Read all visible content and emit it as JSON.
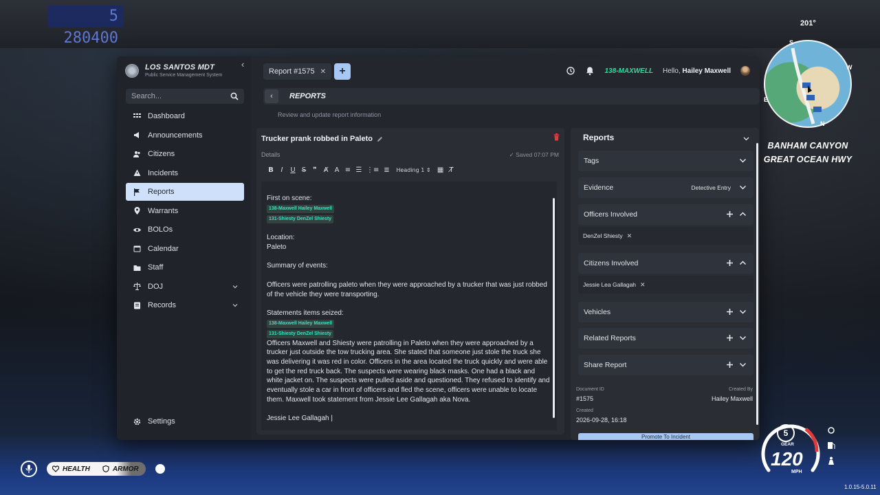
{
  "background": {
    "radio_display": "5 280400"
  },
  "brand": {
    "title": "LOS SANTOS MDT",
    "subtitle": "Public Service Management System"
  },
  "search": {
    "placeholder": "Search..."
  },
  "sidebar": {
    "items": [
      {
        "label": "Dashboard",
        "icon": "grid-icon"
      },
      {
        "label": "Announcements",
        "icon": "megaphone-icon"
      },
      {
        "label": "Citizens",
        "icon": "users-icon"
      },
      {
        "label": "Incidents",
        "icon": "warning-icon"
      },
      {
        "label": "Reports",
        "icon": "flag-icon",
        "active": true
      },
      {
        "label": "Warrants",
        "icon": "pin-icon"
      },
      {
        "label": "BOLOs",
        "icon": "eye-icon"
      },
      {
        "label": "Calendar",
        "icon": "calendar-icon"
      },
      {
        "label": "Staff",
        "icon": "folder-icon"
      },
      {
        "label": "DOJ",
        "icon": "scale-icon",
        "dropdown": true
      },
      {
        "label": "Records",
        "icon": "records-icon",
        "dropdown": true
      }
    ],
    "settings_label": "Settings"
  },
  "tabs": [
    {
      "label": "Report #1575"
    }
  ],
  "topbar": {
    "callsign": "138-MAXWELL",
    "hello_prefix": "Hello,",
    "user_name": "Hailey Maxwell"
  },
  "header": {
    "title": "REPORTS",
    "subtitle": "Review and update report information"
  },
  "editor": {
    "report_title": "Trucker prank robbed in Paleto",
    "details_label": "Details",
    "saved_text": "✓ Saved 07:07 PM",
    "heading_select": "Heading 1 ⇕",
    "content": {
      "first_on_scene_label": "First on scene:",
      "officer_tag_1": "138-Maxwell Hailey Maxwell",
      "officer_tag_2": "131-Shiesty DenZel Shiesty",
      "location_label": "Location:",
      "location_value": "Paleto",
      "summary_label": "Summary of events:",
      "summary_text": "Officers were patrolling paleto when they were approached by a trucker that was just robbed of the vehicle they were transporting.",
      "statements_label": "Statements items seized:",
      "statement_text": "Officers Maxwell and Shiesty were patrolling in Paleto when they were approached by a trucker just outside the tow trucking area. She stated that someone just stole the truck she was delivering it was red in color. Officers in the area located the truck quickly and were able to get the red truck back. The suspects were wearing black masks. One had a black and white jacket on. The suspects were pulled aside and questioned. They refused to identify and eventually stole a car in front of officers and fled the scene, officers were unable to locate them. Maxwell took statement from  Jessie Lee Gallagah aka Nova.",
      "last_line": "Jessie Lee Gallagah |"
    }
  },
  "right_panel": {
    "title": "Reports",
    "sections": {
      "tags": "Tags",
      "evidence": "Evidence",
      "evidence_extra": "Detective Entry",
      "officers": "Officers Involved",
      "officer_chip": "DenZel Shiesty",
      "citizens": "Citizens Involved",
      "citizen_chip": "Jessie Lea Gallagah",
      "vehicles": "Vehicles",
      "related": "Related Reports",
      "share": "Share Report"
    },
    "meta": {
      "document_id_label": "Document ID",
      "document_id": "#1575",
      "created_by_label": "Created By",
      "created_by": "Hailey Maxwell",
      "created_label": "Created",
      "created": "2026-09-28, 16:18"
    },
    "promote_button": "Promote To Incident"
  },
  "hud": {
    "heading": "201°",
    "compass": {
      "n": "N",
      "w": "W",
      "s": "S",
      "e": "E"
    },
    "location_line1": "BANHAM CANYON",
    "location_line2": "GREAT OCEAN HWY",
    "health_label": "HEALTH",
    "armor_label": "ARMOR",
    "gear": "5",
    "gear_label": "GEAR",
    "speed": "120",
    "speed_unit": "MPH",
    "version": "1.0.15-5.0.11"
  }
}
